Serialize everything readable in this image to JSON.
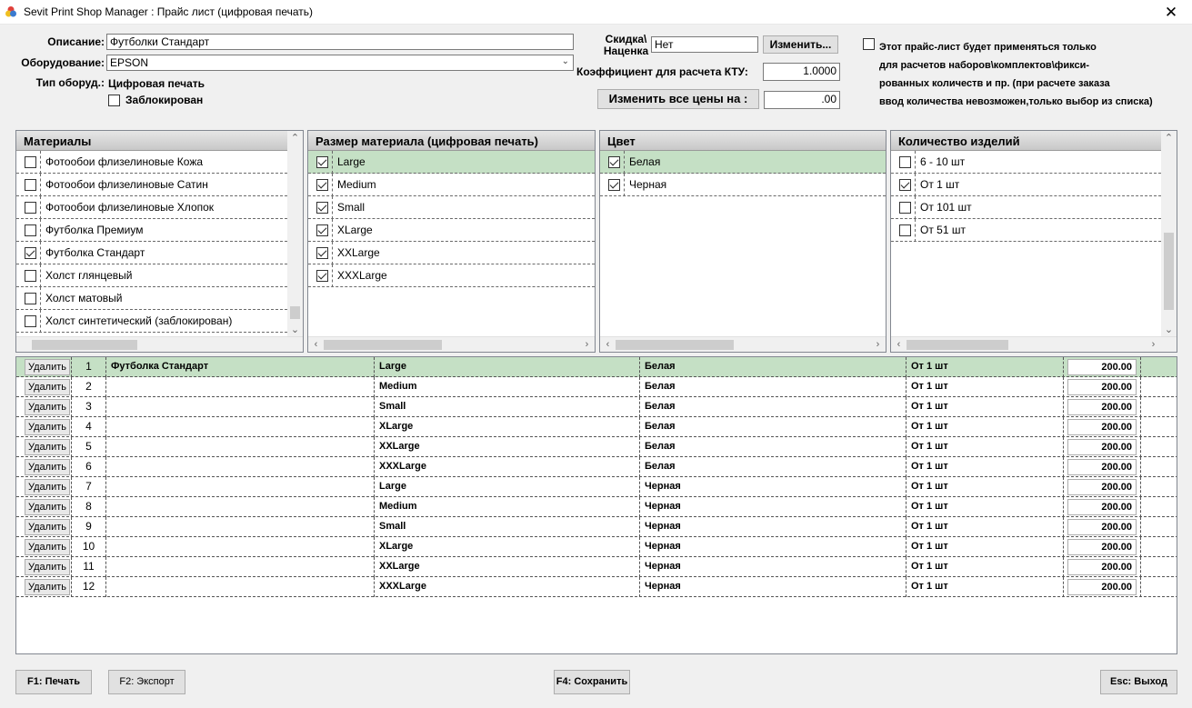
{
  "window": {
    "title": "Sevit Print Shop Manager : Прайс лист (цифровая печать)",
    "close": "✕"
  },
  "form": {
    "description_label": "Описание:",
    "description_value": "Футболки Стандарт",
    "equipment_label": "Оборудование:",
    "equipment_value": "EPSON",
    "equipment_type_label": "Тип оборуд.:",
    "equipment_type_value": "Цифровая печать",
    "blocked_label": "Заблокирован",
    "blocked_checked": false,
    "discount_label_1": "Скидка\\",
    "discount_label_2": "Наценка",
    "discount_value": "Нет",
    "change_button": "Изменить...",
    "kty_label": "Коэффициент для расчета КТУ:",
    "kty_value": "1.0000",
    "change_all_button": "Изменить все цены на :",
    "change_all_value": ".00",
    "note_lines": [
      "Этот прайс-лист будет применяться только",
      "для расчетов наборов\\комплектов\\фикси-",
      "рованных количеств и пр. (при расчете заказа",
      "ввод количества невозможен,только выбор из списка)"
    ]
  },
  "panels": {
    "materials": {
      "title": "Материалы",
      "items": [
        {
          "label": "Фотообои флизелиновые Кожа",
          "checked": false
        },
        {
          "label": "Фотообои флизелиновые Сатин",
          "checked": false
        },
        {
          "label": "Фотообои флизелиновые Хлопок",
          "checked": false
        },
        {
          "label": "Футболка Премиум",
          "checked": false
        },
        {
          "label": "Футболка Стандарт",
          "checked": true
        },
        {
          "label": "Холст глянцевый",
          "checked": false
        },
        {
          "label": "Холст матовый",
          "checked": false
        },
        {
          "label": "Холст синтетический (заблокирован)",
          "checked": false
        }
      ]
    },
    "sizes": {
      "title": "Размер материала (цифровая печать)",
      "items": [
        {
          "label": "Large",
          "checked": true
        },
        {
          "label": "Medium",
          "checked": true
        },
        {
          "label": "Small",
          "checked": true
        },
        {
          "label": "XLarge",
          "checked": true
        },
        {
          "label": "XXLarge",
          "checked": true
        },
        {
          "label": "XXXLarge",
          "checked": true
        }
      ]
    },
    "colors": {
      "title": "Цвет",
      "items": [
        {
          "label": "Белая",
          "checked": true
        },
        {
          "label": "Черная",
          "checked": true
        }
      ]
    },
    "quantities": {
      "title": "Количество изделий",
      "items": [
        {
          "label": "6 - 10 шт",
          "checked": false
        },
        {
          "label": "От 1 шт",
          "checked": true
        },
        {
          "label": "От 101 шт",
          "checked": false
        },
        {
          "label": "От 51 шт",
          "checked": false
        }
      ]
    }
  },
  "grid": {
    "delete_label": "Удалить",
    "rows": [
      {
        "n": "1",
        "material": "Футболка Стандарт",
        "size": "Large",
        "color": "Белая",
        "qty": "От 1 шт",
        "price": "200.00"
      },
      {
        "n": "2",
        "material": "",
        "size": "Medium",
        "color": "Белая",
        "qty": "От 1 шт",
        "price": "200.00"
      },
      {
        "n": "3",
        "material": "",
        "size": "Small",
        "color": "Белая",
        "qty": "От 1 шт",
        "price": "200.00"
      },
      {
        "n": "4",
        "material": "",
        "size": "XLarge",
        "color": "Белая",
        "qty": "От 1 шт",
        "price": "200.00"
      },
      {
        "n": "5",
        "material": "",
        "size": "XXLarge",
        "color": "Белая",
        "qty": "От 1 шт",
        "price": "200.00"
      },
      {
        "n": "6",
        "material": "",
        "size": "XXXLarge",
        "color": "Белая",
        "qty": "От 1 шт",
        "price": "200.00"
      },
      {
        "n": "7",
        "material": "",
        "size": "Large",
        "color": "Черная",
        "qty": "От 1 шт",
        "price": "200.00"
      },
      {
        "n": "8",
        "material": "",
        "size": "Medium",
        "color": "Черная",
        "qty": "От 1 шт",
        "price": "200.00"
      },
      {
        "n": "9",
        "material": "",
        "size": "Small",
        "color": "Черная",
        "qty": "От 1 шт",
        "price": "200.00"
      },
      {
        "n": "10",
        "material": "",
        "size": "XLarge",
        "color": "Черная",
        "qty": "От 1 шт",
        "price": "200.00"
      },
      {
        "n": "11",
        "material": "",
        "size": "XXLarge",
        "color": "Черная",
        "qty": "От 1 шт",
        "price": "200.00"
      },
      {
        "n": "12",
        "material": "",
        "size": "XXXLarge",
        "color": "Черная",
        "qty": "От 1 шт",
        "price": "200.00"
      }
    ]
  },
  "footer": {
    "print": "F1: Печать",
    "export": "F2: Экспорт",
    "save": "F4: Сохранить",
    "exit": "Esc: Выход"
  },
  "colors": {
    "selected_row": "#c5e0c5",
    "panel_header": "#d4d4d4"
  }
}
